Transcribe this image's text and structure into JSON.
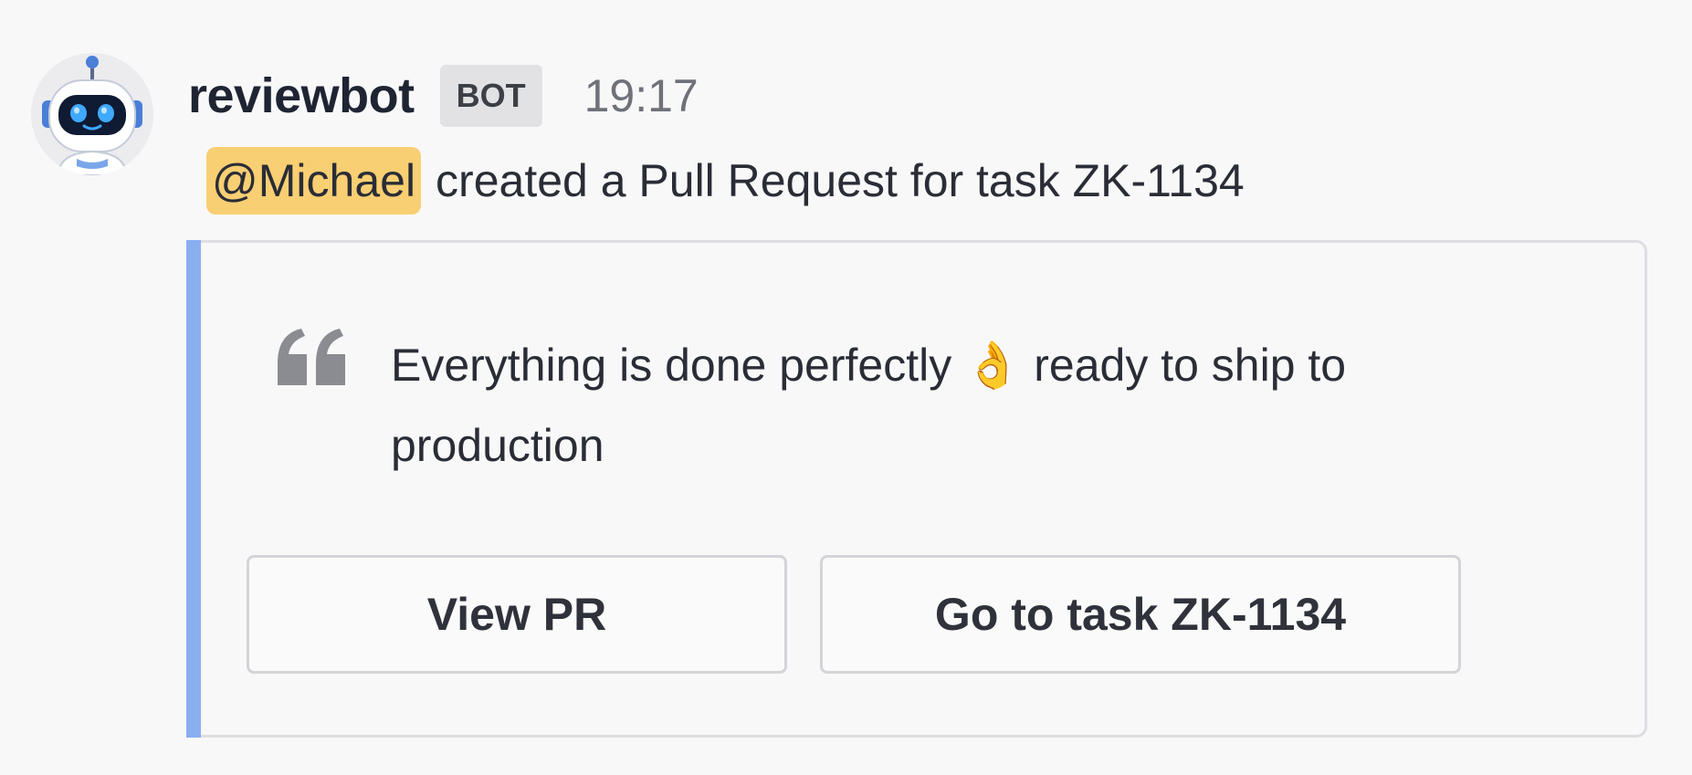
{
  "message": {
    "author": "reviewbot",
    "badge": "BOT",
    "time": "19:17",
    "mention": "@Michael",
    "text": "created a Pull Request for task ZK-1134",
    "avatar_icon": "robot-icon"
  },
  "attachment": {
    "accent_color": "#8aaef0",
    "quote_icon": "quote-icon",
    "quote_text": "Everything is done perfectly 👌 ready to ship to production",
    "buttons": {
      "view_pr": "View PR",
      "go_to_task": "Go to task ZK-1134"
    }
  },
  "colors": {
    "mention_highlight": "#f9cf73",
    "badge_background": "#e2e2e5"
  }
}
